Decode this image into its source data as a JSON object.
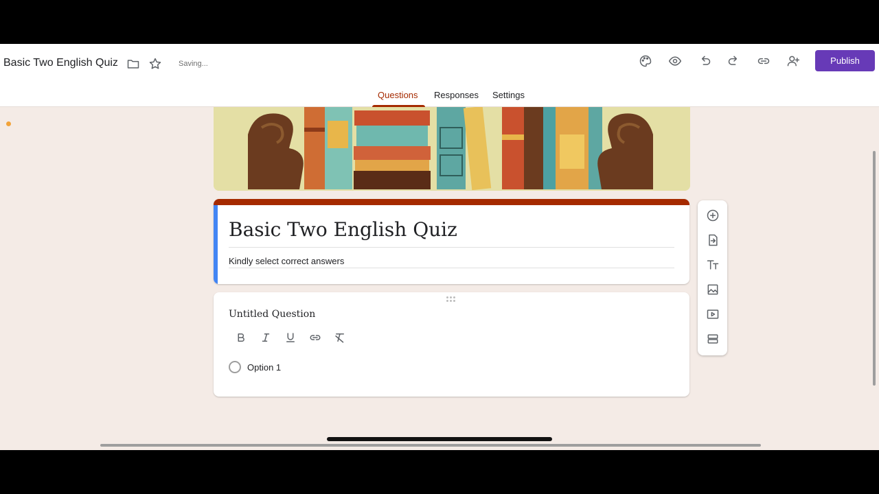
{
  "header": {
    "doc_title": "Basic Two English Quiz",
    "saving_status": "Saving...",
    "publish_label": "Publish",
    "icons": [
      "folder-icon",
      "star-icon",
      "palette-icon",
      "eye-icon",
      "undo-icon",
      "redo-icon",
      "link-icon",
      "add-person-icon"
    ]
  },
  "tabs": [
    {
      "label": "Questions",
      "active": true
    },
    {
      "label": "Responses",
      "active": false
    },
    {
      "label": "Settings",
      "active": false
    }
  ],
  "form": {
    "title": "Basic Two English Quiz",
    "description": "Kindly select correct answers"
  },
  "question": {
    "title": "Untitled Question",
    "formatting": [
      "bold-icon",
      "italic-icon",
      "underline-icon",
      "link-icon",
      "clear-format-icon"
    ],
    "options": [
      {
        "label": "Option 1"
      }
    ]
  },
  "side_toolbar": [
    "add-question-icon",
    "import-questions-icon",
    "add-title-icon",
    "add-image-icon",
    "add-video-icon",
    "add-section-icon"
  ],
  "colors": {
    "theme": "#a52a00",
    "accent_left": "#4285f4",
    "publish": "#673ab7",
    "background": "#f4ebe6"
  }
}
